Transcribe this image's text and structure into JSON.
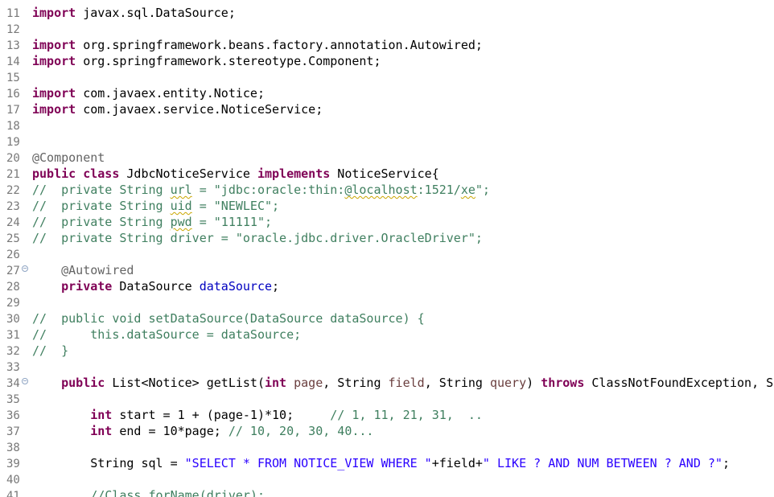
{
  "editor": {
    "lines": [
      {
        "num": "11",
        "fold": false,
        "tokens": [
          {
            "t": "import",
            "c": "kw"
          },
          {
            "t": " javax.sql.DataSource;",
            "c": "plain"
          }
        ]
      },
      {
        "num": "12",
        "fold": false,
        "tokens": []
      },
      {
        "num": "13",
        "fold": false,
        "tokens": [
          {
            "t": "import",
            "c": "kw"
          },
          {
            "t": " org.springframework.beans.factory.annotation.Autowired;",
            "c": "plain"
          }
        ]
      },
      {
        "num": "14",
        "fold": false,
        "tokens": [
          {
            "t": "import",
            "c": "kw"
          },
          {
            "t": " org.springframework.stereotype.Component;",
            "c": "plain"
          }
        ]
      },
      {
        "num": "15",
        "fold": false,
        "tokens": []
      },
      {
        "num": "16",
        "fold": false,
        "tokens": [
          {
            "t": "import",
            "c": "kw"
          },
          {
            "t": " com.javaex.entity.Notice;",
            "c": "plain"
          }
        ]
      },
      {
        "num": "17",
        "fold": false,
        "tokens": [
          {
            "t": "import",
            "c": "kw"
          },
          {
            "t": " com.javaex.service.NoticeService;",
            "c": "plain"
          }
        ]
      },
      {
        "num": "18",
        "fold": false,
        "tokens": []
      },
      {
        "num": "19",
        "fold": false,
        "tokens": []
      },
      {
        "num": "20",
        "fold": false,
        "tokens": [
          {
            "t": "@Component",
            "c": "annotation"
          }
        ]
      },
      {
        "num": "21",
        "fold": false,
        "tokens": [
          {
            "t": "public",
            "c": "kw"
          },
          {
            "t": " ",
            "c": "plain"
          },
          {
            "t": "class",
            "c": "kw"
          },
          {
            "t": " JdbcNoticeService ",
            "c": "plain"
          },
          {
            "t": "implements",
            "c": "kw"
          },
          {
            "t": " NoticeService{",
            "c": "plain"
          }
        ]
      },
      {
        "num": "22",
        "fold": false,
        "tokens": [
          {
            "t": "//  private String ",
            "c": "comment"
          },
          {
            "t": "url",
            "c": "comment",
            "sq": true
          },
          {
            "t": " = \"jdbc:oracle:thin:",
            "c": "comment"
          },
          {
            "t": "@localhost",
            "c": "comment",
            "sq": true
          },
          {
            "t": ":1521/",
            "c": "comment"
          },
          {
            "t": "xe",
            "c": "comment",
            "sq": true
          },
          {
            "t": "\";",
            "c": "comment"
          }
        ]
      },
      {
        "num": "23",
        "fold": false,
        "tokens": [
          {
            "t": "//  private String ",
            "c": "comment"
          },
          {
            "t": "uid",
            "c": "comment",
            "sq": true
          },
          {
            "t": " = \"NEWLEC\";",
            "c": "comment"
          }
        ]
      },
      {
        "num": "24",
        "fold": false,
        "tokens": [
          {
            "t": "//  private String ",
            "c": "comment"
          },
          {
            "t": "pwd",
            "c": "comment",
            "sq": true
          },
          {
            "t": " = \"11111\";",
            "c": "comment"
          }
        ]
      },
      {
        "num": "25",
        "fold": false,
        "tokens": [
          {
            "t": "//  private String driver = \"oracle.jdbc.driver.OracleDriver\";",
            "c": "comment"
          }
        ]
      },
      {
        "num": "26",
        "fold": false,
        "tokens": []
      },
      {
        "num": "27",
        "fold": true,
        "tokens": [
          {
            "t": "    ",
            "c": "plain"
          },
          {
            "t": "@Autowired",
            "c": "annotation"
          }
        ]
      },
      {
        "num": "28",
        "fold": false,
        "tokens": [
          {
            "t": "    ",
            "c": "plain"
          },
          {
            "t": "private",
            "c": "kw"
          },
          {
            "t": " DataSource ",
            "c": "plain"
          },
          {
            "t": "dataSource",
            "c": "field"
          },
          {
            "t": ";",
            "c": "plain"
          }
        ]
      },
      {
        "num": "29",
        "fold": false,
        "tokens": []
      },
      {
        "num": "30",
        "fold": false,
        "tokens": [
          {
            "t": "//  public void setDataSource(DataSource dataSource) {",
            "c": "comment"
          }
        ]
      },
      {
        "num": "31",
        "fold": false,
        "tokens": [
          {
            "t": "//      this.dataSource = dataSource;",
            "c": "comment"
          }
        ]
      },
      {
        "num": "32",
        "fold": false,
        "tokens": [
          {
            "t": "//  }",
            "c": "comment"
          }
        ]
      },
      {
        "num": "33",
        "fold": false,
        "tokens": []
      },
      {
        "num": "34",
        "fold": true,
        "tokens": [
          {
            "t": "    ",
            "c": "plain"
          },
          {
            "t": "public",
            "c": "kw"
          },
          {
            "t": " List<Notice> getList(",
            "c": "plain"
          },
          {
            "t": "int",
            "c": "kw"
          },
          {
            "t": " ",
            "c": "plain"
          },
          {
            "t": "page",
            "c": "param"
          },
          {
            "t": ", String ",
            "c": "plain"
          },
          {
            "t": "field",
            "c": "param"
          },
          {
            "t": ", String ",
            "c": "plain"
          },
          {
            "t": "query",
            "c": "param"
          },
          {
            "t": ") ",
            "c": "plain"
          },
          {
            "t": "throws",
            "c": "kw"
          },
          {
            "t": " ClassNotFoundException, SQ",
            "c": "plain"
          }
        ]
      },
      {
        "num": "35",
        "fold": false,
        "tokens": []
      },
      {
        "num": "36",
        "fold": false,
        "tokens": [
          {
            "t": "        ",
            "c": "plain"
          },
          {
            "t": "int",
            "c": "kw"
          },
          {
            "t": " start = 1 + (page-1)*10;     ",
            "c": "plain"
          },
          {
            "t": "// 1, 11, 21, 31,  ..",
            "c": "comment"
          }
        ]
      },
      {
        "num": "37",
        "fold": false,
        "tokens": [
          {
            "t": "        ",
            "c": "plain"
          },
          {
            "t": "int",
            "c": "kw"
          },
          {
            "t": " end = 10*page; ",
            "c": "plain"
          },
          {
            "t": "// 10, 20, 30, 40...",
            "c": "comment"
          }
        ]
      },
      {
        "num": "38",
        "fold": false,
        "tokens": []
      },
      {
        "num": "39",
        "fold": false,
        "tokens": [
          {
            "t": "        String sql = ",
            "c": "plain"
          },
          {
            "t": "\"SELECT * FROM NOTICE_VIEW WHERE \"",
            "c": "string"
          },
          {
            "t": "+field+",
            "c": "plain"
          },
          {
            "t": "\" LIKE ? AND NUM BETWEEN ? AND ?\"",
            "c": "string"
          },
          {
            "t": ";",
            "c": "plain"
          }
        ]
      },
      {
        "num": "40",
        "fold": false,
        "tokens": []
      },
      {
        "num": "41",
        "fold": false,
        "tokens": [
          {
            "t": "        ",
            "c": "plain"
          },
          {
            "t": "//Class.forName(driver);",
            "c": "comment"
          }
        ]
      }
    ]
  }
}
